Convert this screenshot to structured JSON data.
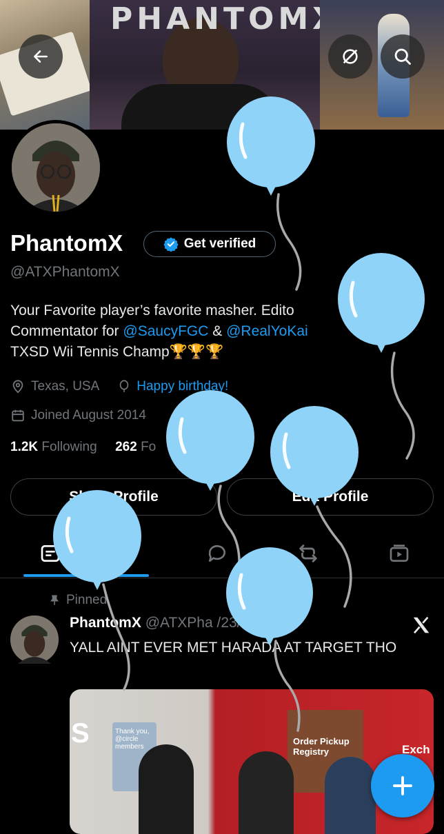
{
  "banner": {
    "title": "PHANTOMX"
  },
  "profile": {
    "display_name": "PhantomX",
    "verify_label": "Get verified",
    "handle": "@ATXPhantomX",
    "bio_line1": "Your Favorite player’s favorite masher. Edito",
    "bio_line2_prefix": "Commentator for ",
    "bio_link1": "@SaucyFGC",
    "bio_amp": " & ",
    "bio_link2": "@RealYoKai",
    "bio_line3": "TXSD Wii Tennis Champ",
    "bio_emoji": "🏆🏆🏆",
    "location": "Texas, USA",
    "birthday": "Happy birthday!",
    "joined": "Joined August 2014",
    "following_count": "1.2K",
    "following_label": "Following",
    "followers_count": "262",
    "followers_label": "Fo"
  },
  "buttons": {
    "share": "Share Profile",
    "edit": "Edit Profile"
  },
  "post": {
    "pinned_label": "Pinned",
    "author": "PhantomX",
    "handle_date": "@ATXPha  /23/25",
    "text": "YALL AINT EVER MET HARADA AT TARGET THO",
    "media_sign1": "Thank you, @circle members",
    "media_sign2": "Order Pickup Registry",
    "media_sign3": "Exch",
    "media_left": "S"
  },
  "colors": {
    "accent": "#1d9bf0",
    "balloon": "#8fd3f8",
    "background": "#000000"
  }
}
